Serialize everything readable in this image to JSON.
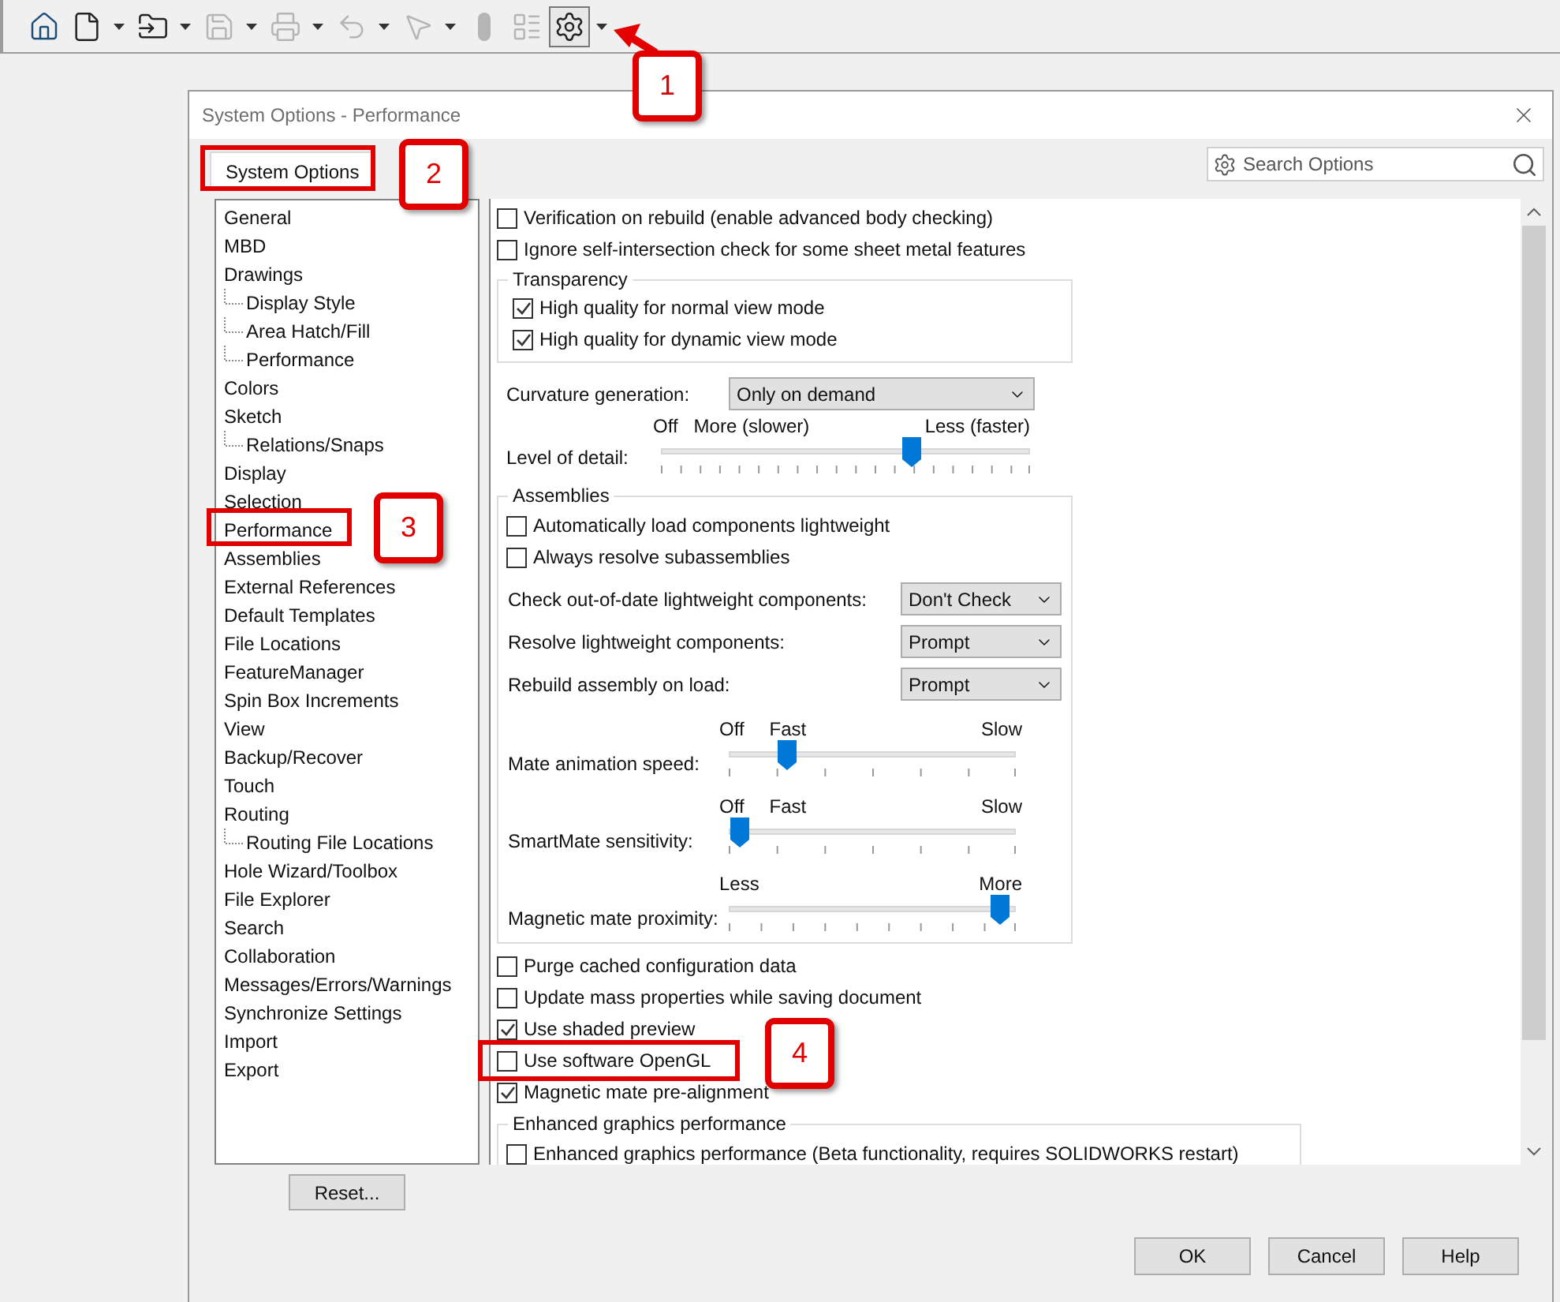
{
  "toolbar": [
    {
      "kind": "home",
      "disabled": false,
      "selected": false,
      "dropdown": false
    },
    {
      "kind": "new",
      "disabled": false,
      "selected": false,
      "dropdown": true
    },
    {
      "kind": "open",
      "disabled": false,
      "selected": false,
      "dropdown": true
    },
    {
      "kind": "save",
      "disabled": true,
      "selected": false,
      "dropdown": true
    },
    {
      "kind": "print",
      "disabled": true,
      "selected": false,
      "dropdown": true
    },
    {
      "kind": "undo",
      "disabled": true,
      "selected": false,
      "dropdown": true
    },
    {
      "kind": "select",
      "disabled": true,
      "selected": false,
      "dropdown": true
    },
    {
      "kind": "rebuild",
      "disabled": true,
      "selected": false,
      "dropdown": false
    },
    {
      "kind": "list",
      "disabled": true,
      "selected": false,
      "dropdown": false
    },
    {
      "kind": "options",
      "disabled": false,
      "selected": true,
      "dropdown": true
    }
  ],
  "dialog": {
    "title": "System Options - Performance",
    "tabs": [
      {
        "label": "System Options",
        "selected": true
      }
    ],
    "search": {
      "placeholder": "Search Options"
    },
    "tree": [
      {
        "label": "General"
      },
      {
        "label": "MBD"
      },
      {
        "label": "Drawings",
        "children": [
          {
            "label": "Display Style"
          },
          {
            "label": "Area Hatch/Fill"
          },
          {
            "label": "Performance"
          }
        ]
      },
      {
        "label": "Colors"
      },
      {
        "label": "Sketch",
        "children": [
          {
            "label": "Relations/Snaps"
          }
        ]
      },
      {
        "label": "Display"
      },
      {
        "label": "Selection"
      },
      {
        "label": "Performance"
      },
      {
        "label": "Assemblies"
      },
      {
        "label": "External References"
      },
      {
        "label": "Default Templates"
      },
      {
        "label": "File Locations"
      },
      {
        "label": "FeatureManager"
      },
      {
        "label": "Spin Box Increments"
      },
      {
        "label": "View"
      },
      {
        "label": "Backup/Recover"
      },
      {
        "label": "Touch"
      },
      {
        "label": "Routing",
        "children": [
          {
            "label": "Routing File Locations"
          }
        ]
      },
      {
        "label": "Hole Wizard/Toolbox"
      },
      {
        "label": "File Explorer"
      },
      {
        "label": "Search"
      },
      {
        "label": "Collaboration"
      },
      {
        "label": "Messages/Errors/Warnings"
      },
      {
        "label": "Synchronize Settings"
      },
      {
        "label": "Import"
      },
      {
        "label": "Export"
      }
    ],
    "reset_button": "Reset...",
    "options_top": [
      {
        "label": "Verification on rebuild (enable advanced body checking)",
        "checked": false
      },
      {
        "label": "Ignore self-intersection check for some sheet metal features",
        "checked": false
      }
    ],
    "transparency": {
      "title": "Transparency",
      "options": [
        {
          "label": "High quality for normal view mode",
          "checked": true
        },
        {
          "label": "High quality for dynamic view mode",
          "checked": true
        }
      ]
    },
    "curvature": {
      "label": "Curvature generation:",
      "value": "Only on demand"
    },
    "level_of_detail": {
      "label": "Level of detail:",
      "marks": [
        "Off",
        "More (slower)",
        "Less (faster)"
      ],
      "level": 0.69
    },
    "assemblies": {
      "title": "Assemblies",
      "options": [
        {
          "label": "Automatically load components lightweight",
          "checked": false
        },
        {
          "label": "Always resolve subassemblies",
          "checked": false
        }
      ],
      "dropdowns": [
        {
          "label": "Check out-of-date lightweight components:",
          "value": "Don't Check"
        },
        {
          "label": "Resolve lightweight components:",
          "value": "Prompt"
        },
        {
          "label": "Rebuild assembly on load:",
          "value": "Prompt"
        }
      ],
      "sliders": [
        {
          "label": "Mate animation speed:",
          "marks": [
            "Off",
            "Fast",
            "Slow"
          ],
          "level": 0.18
        },
        {
          "label": "SmartMate sensitivity:",
          "marks": [
            "Off",
            "Fast",
            "Slow"
          ],
          "level": 0
        },
        {
          "label": "Magnetic mate proximity:",
          "marks": [
            "Less",
            "More"
          ],
          "level": 0.98
        }
      ]
    },
    "options_bottom": [
      {
        "label": "Purge cached configuration data",
        "checked": false
      },
      {
        "label": "Update mass properties while saving document",
        "checked": false
      },
      {
        "label": "Use shaded preview",
        "checked": true
      },
      {
        "label": "Use software OpenGL",
        "checked": false
      },
      {
        "label": "Magnetic mate pre-alignment",
        "checked": true
      }
    ],
    "enhanced": {
      "title": "Enhanced graphics performance",
      "options": [
        {
          "label": "Enhanced graphics performance (Beta functionality, requires SOLIDWORKS restart)",
          "checked": false
        }
      ]
    },
    "buttons": [
      "OK",
      "Cancel",
      "Help"
    ]
  },
  "callouts": [
    {
      "label": "1"
    },
    {
      "label": "2"
    },
    {
      "label": "3"
    },
    {
      "label": "4"
    }
  ]
}
